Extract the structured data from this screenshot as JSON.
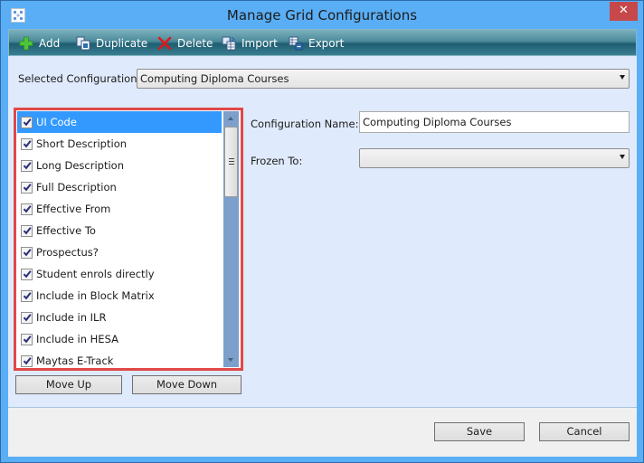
{
  "window": {
    "title": "Manage Grid Configurations",
    "close_label": "✕"
  },
  "toolbar": {
    "add_label": "Add",
    "duplicate_label": "Duplicate",
    "delete_label": "Delete",
    "import_label": "Import",
    "export_label": "Export"
  },
  "selected_configuration": {
    "label": "Selected Configuration:",
    "value": "Computing Diploma Courses"
  },
  "columns_list": {
    "items": [
      {
        "label": "UI Code",
        "checked": true,
        "selected": true
      },
      {
        "label": "Short Description",
        "checked": true,
        "selected": false
      },
      {
        "label": "Long Description",
        "checked": true,
        "selected": false
      },
      {
        "label": "Full Description",
        "checked": true,
        "selected": false
      },
      {
        "label": "Effective From",
        "checked": true,
        "selected": false
      },
      {
        "label": "Effective To",
        "checked": true,
        "selected": false
      },
      {
        "label": "Prospectus?",
        "checked": true,
        "selected": false
      },
      {
        "label": "Student enrols directly",
        "checked": true,
        "selected": false
      },
      {
        "label": "Include in Block Matrix",
        "checked": true,
        "selected": false
      },
      {
        "label": "Include in ILR",
        "checked": true,
        "selected": false
      },
      {
        "label": "Include in HESA",
        "checked": true,
        "selected": false
      },
      {
        "label": "Maytas E-Track",
        "checked": true,
        "selected": false
      }
    ],
    "move_up_label": "Move Up",
    "move_down_label": "Move Down"
  },
  "details": {
    "configuration_name_label": "Configuration Name:",
    "configuration_name_value": "Computing Diploma Courses",
    "frozen_to_label": "Frozen To:",
    "frozen_to_value": ""
  },
  "footer": {
    "save_label": "Save",
    "cancel_label": "Cancel"
  },
  "colors": {
    "selection": "#3399ff",
    "highlight_border": "#e04848",
    "window_frame": "#5aaef5",
    "close_button": "#c7484a"
  }
}
